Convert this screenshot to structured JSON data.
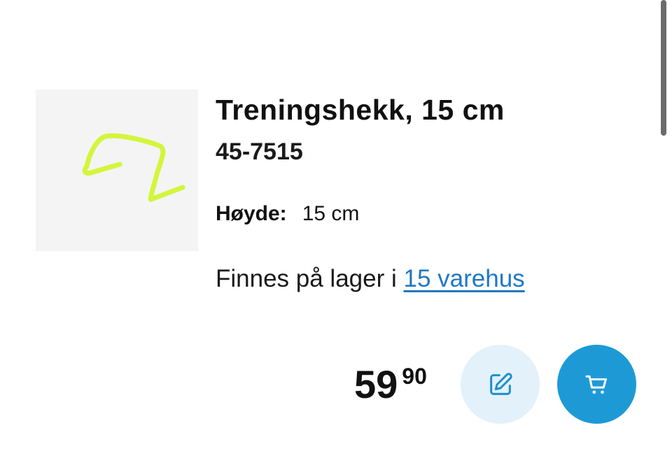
{
  "product": {
    "title": "Treningshekk, 15 cm",
    "sku": "45-7515",
    "spec": {
      "label": "Høyde:",
      "value": "15 cm"
    },
    "stock": {
      "text": "Finnes på lager i ",
      "link": "15 varehus"
    },
    "price": {
      "integer": "59",
      "decimal": "90"
    }
  },
  "icons": {
    "product_image": "hurdle-image",
    "edit": "pencil-square-icon",
    "cart": "shopping-cart-icon"
  },
  "colors": {
    "link": "#1f78c4",
    "edit_button_bg": "#e3f1fa",
    "cart_button_bg": "#1d9ad6",
    "hurdle": "#d4f53c"
  }
}
